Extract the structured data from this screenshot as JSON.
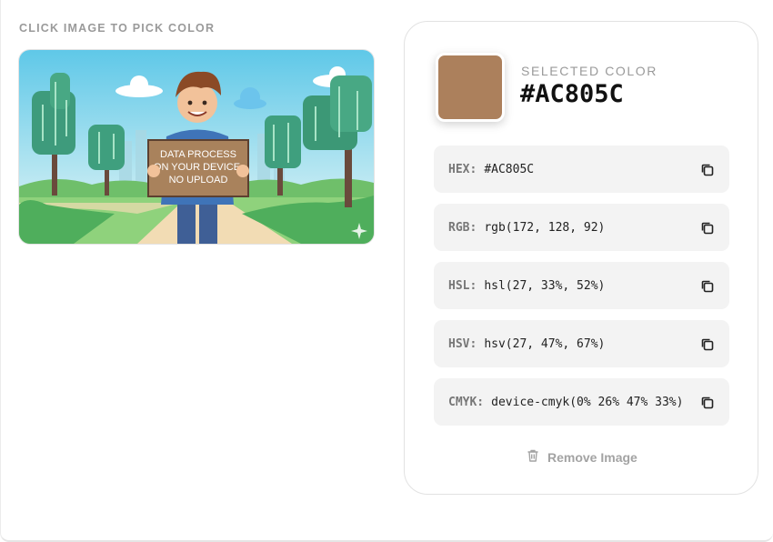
{
  "picker": {
    "instruction": "CLICK IMAGE TO PICK COLOR",
    "sign_lines": [
      "DATA PROCESS",
      "ON YOUR DEVICE,",
      "NO UPLOAD"
    ]
  },
  "selected": {
    "label": "SELECTED COLOR",
    "hex": "#AC805C",
    "swatch_color": "#AC805C"
  },
  "formats": [
    {
      "key": "HEX:",
      "value": "#AC805C"
    },
    {
      "key": "RGB:",
      "value": "rgb(172, 128, 92)"
    },
    {
      "key": "HSL:",
      "value": "hsl(27, 33%, 52%)"
    },
    {
      "key": "HSV:",
      "value": "hsv(27, 47%, 67%)"
    },
    {
      "key": "CMYK:",
      "value": "device-cmyk(0% 26% 47% 33%)"
    }
  ],
  "actions": {
    "remove_label": "Remove Image"
  },
  "icons": {
    "copy": "copy-icon",
    "trash": "trash-icon"
  }
}
